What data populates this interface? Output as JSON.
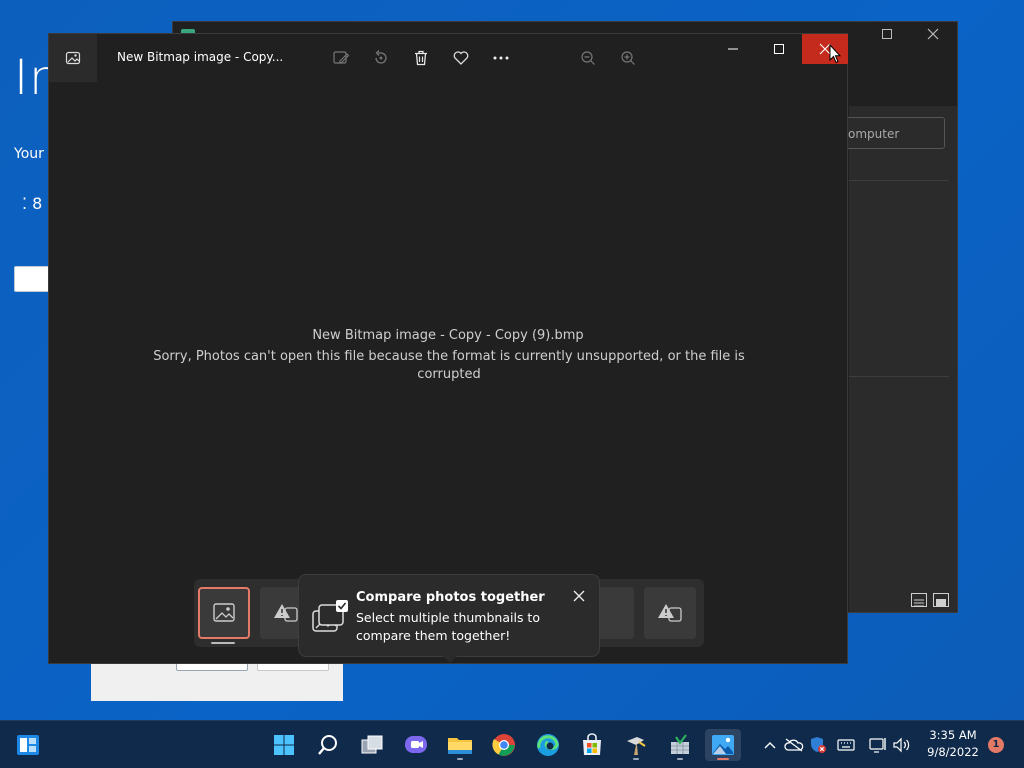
{
  "background_app": {
    "heading": "In",
    "subtext": "Your",
    "dots": "⁚ 8"
  },
  "background_window": {
    "search_partial": "omputer"
  },
  "photos_window": {
    "title": "New Bitmap image - Copy...",
    "filename": "New Bitmap image - Copy - Copy (9).bmp",
    "error_message": "Sorry, Photos can't open this file because the format is currently unsupported, or the file is corrupted",
    "toolbar": [
      "edit-image-icon",
      "rotate-icon",
      "delete-icon",
      "favorite-icon",
      "more-icon",
      "zoom-out-icon",
      "zoom-in-icon"
    ],
    "close_color": "#c42b1c"
  },
  "teaching_tip": {
    "title": "Compare photos together",
    "body": "Select multiple thumbnails to compare them together!"
  },
  "taskbar": {
    "apps": [
      "start",
      "search",
      "task-view",
      "chat",
      "file-explorer",
      "chrome",
      "edge",
      "store",
      "tool-app",
      "spreadsheet-app",
      "photos"
    ],
    "clock_time": "3:35 AM",
    "clock_date": "9/8/2022",
    "notification_count": "1"
  },
  "colors": {
    "accent": "#e27a67",
    "desktop": "#0a62c2",
    "taskbar": "#0f2a4a"
  }
}
